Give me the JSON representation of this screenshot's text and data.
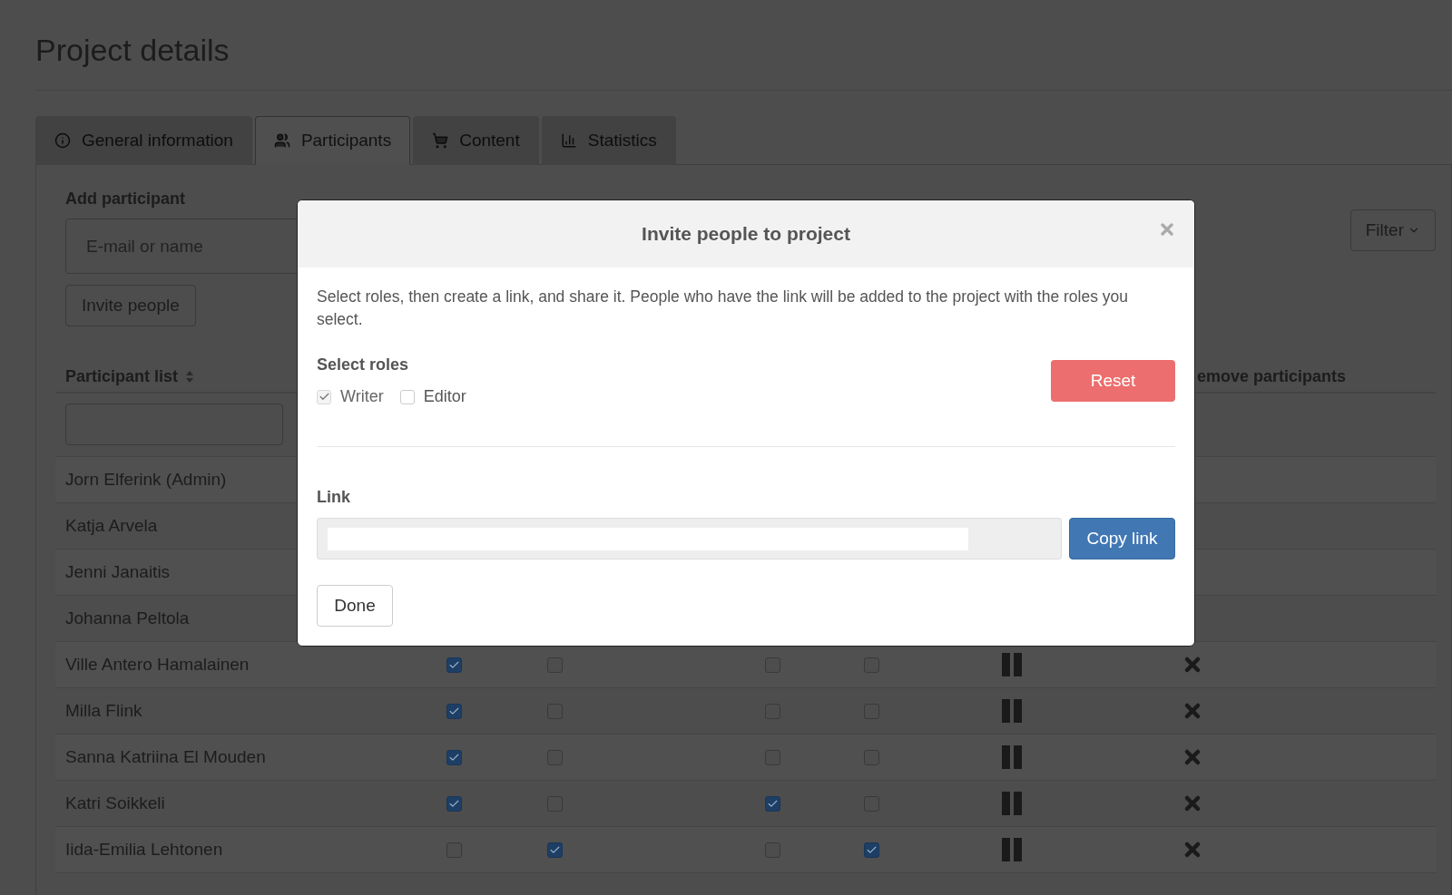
{
  "page": {
    "title": "Project details"
  },
  "tabs": [
    {
      "label": "General information",
      "selected": false
    },
    {
      "label": "Participants",
      "selected": true
    },
    {
      "label": "Content",
      "selected": false
    },
    {
      "label": "Statistics",
      "selected": false
    }
  ],
  "add_participant": {
    "label": "Add participant",
    "placeholder": "E-mail or name",
    "button": "Invite people"
  },
  "filter_button": "Filter",
  "participant_list": {
    "heading": "Participant list",
    "column_header": "emove participants",
    "rows": [
      {
        "name": "Jorn Elferink (Admin)"
      },
      {
        "name": "Katja Arvela"
      },
      {
        "name": "Jenni Janaitis"
      },
      {
        "name": "Johanna Peltola"
      },
      {
        "name": "Ville Antero Hamalainen",
        "checks": [
          true,
          false,
          false,
          false
        ]
      },
      {
        "name": "Milla Flink",
        "checks": [
          true,
          false,
          false,
          false
        ]
      },
      {
        "name": "Sanna Katriina El Mouden",
        "checks": [
          true,
          false,
          false,
          false
        ]
      },
      {
        "name": "Katri Soikkeli",
        "checks": [
          true,
          false,
          true,
          false
        ]
      },
      {
        "name": "Iida-Emilia Lehtonen",
        "checks": [
          false,
          true,
          false,
          true
        ]
      }
    ]
  },
  "modal": {
    "title": "Invite people to project",
    "description": "Select roles, then create a link, and share it. People who have the link will be added to the project with the roles you select.",
    "roles_label": "Select roles",
    "roles": [
      {
        "label": "Writer",
        "checked": true,
        "disabled": true
      },
      {
        "label": "Editor",
        "checked": false,
        "disabled": false
      }
    ],
    "reset": "Reset",
    "link_label": "Link",
    "copy": "Copy link",
    "done": "Done"
  }
}
